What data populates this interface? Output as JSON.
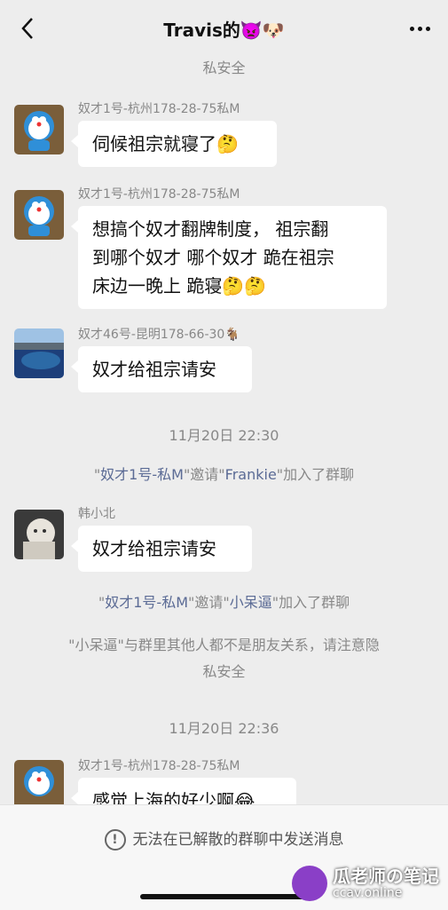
{
  "header": {
    "title": "Travis的👿🐶"
  },
  "system": {
    "top_partial": "私安全",
    "time1": "11月20日 22:30",
    "invite1": {
      "q1": "\"",
      "name1": "奴才1号-私M",
      "mid": "\"邀请\"",
      "name2": "Frankie",
      "end": "\"加入了群聊"
    },
    "invite2": {
      "q1": "\"",
      "name1": "奴才1号-私M",
      "mid": "\"邀请\"",
      "name2": "小呆逼",
      "end": "\"加入了群聊"
    },
    "notice_line1": "\"小呆逼\"与群里其他人都不是朋友关系，请注意隐",
    "notice_line2": "私安全",
    "time2": "11月20日 22:36"
  },
  "messages": [
    {
      "sender": "奴才1号-杭州178-28-75私M",
      "text": "伺候祖宗就寝了🤔"
    },
    {
      "sender": "奴才1号-杭州178-28-75私M",
      "line1": "想搞个奴才翻牌制度， 祖宗翻",
      "line2": "到哪个奴才 哪个奴才 跪在祖宗",
      "line3": "床边一晚上 跪寝🤔🤔"
    },
    {
      "sender": "奴才46号-昆明178-66-30🐐",
      "text": "奴才给祖宗请安"
    },
    {
      "sender": "韩小北",
      "text": "奴才给祖宗请安"
    },
    {
      "sender": "奴才1号-杭州178-28-75私M",
      "text": "感觉上海的好少啊😂"
    }
  ],
  "footer": {
    "notice": "无法在已解散的群聊中发送消息",
    "notice_icon": "!"
  },
  "watermark": {
    "text": "瓜老师の笔记",
    "sub": "ccav.online"
  }
}
